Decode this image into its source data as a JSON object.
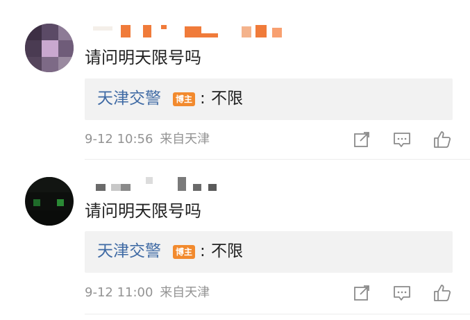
{
  "comments": [
    {
      "text": "请问明天限号吗",
      "reply": {
        "author": "天津交警",
        "badge": "博主",
        "separator": ":",
        "text": "不限"
      },
      "meta": {
        "time": "9-12 10:56",
        "source": "来自天津"
      },
      "actions": [
        "share-icon",
        "comment-icon",
        "like-icon"
      ]
    },
    {
      "text": "请问明天限号吗",
      "reply": {
        "author": "天津交警",
        "badge": "博主",
        "separator": ":",
        "text": "不限"
      },
      "meta": {
        "time": "9-12 11:00",
        "source": "来自天津"
      },
      "actions": [
        "share-icon",
        "comment-icon",
        "like-icon"
      ]
    }
  ],
  "colors": {
    "author_link": "#3f6aa4",
    "badge": "#f28a2e",
    "meta_text": "#939393",
    "reply_bg": "#f2f2f2"
  }
}
